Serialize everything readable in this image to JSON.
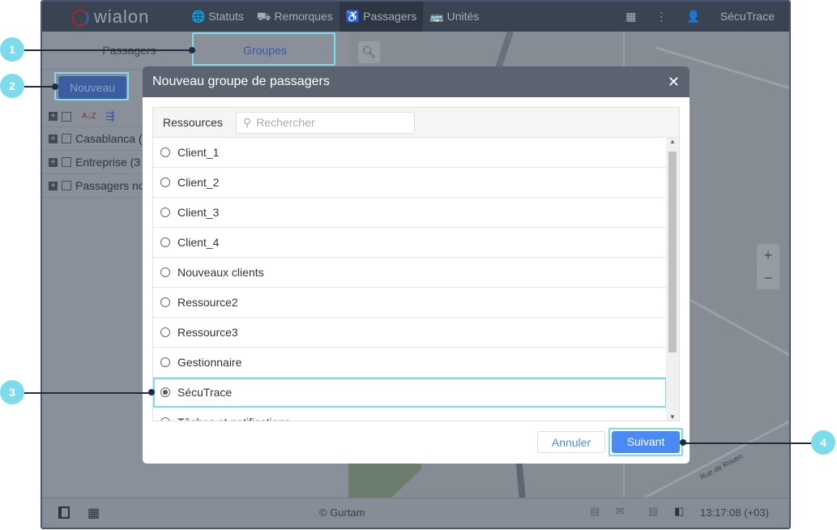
{
  "topbar": {
    "logo": "wialon",
    "nav": [
      "Statuts",
      "Remorques",
      "Passagers",
      "Unités"
    ],
    "user": "SécuTrace"
  },
  "left": {
    "tabs": [
      "Passagers",
      "Groupes"
    ],
    "new_button": "Nouveau",
    "tree": [
      "Casablanca (",
      "Entreprise (3",
      "Passagers no"
    ]
  },
  "dialog": {
    "title": "Nouveau groupe de passagers",
    "resources_label": "Ressources",
    "search_placeholder": "Rechercher",
    "items": [
      "Client_1",
      "Client_2",
      "Client_3",
      "Client_4",
      "Nouveaux clients",
      "Ressource2",
      "Ressource3",
      "Gestionnaire",
      "SécuTrace",
      "Tâches et notifications"
    ],
    "selected": "SécuTrace",
    "cancel": "Annuler",
    "next": "Suivant"
  },
  "bottombar": {
    "copyright": "© Gurtam",
    "time": "13:17:08 (+03)"
  },
  "map": {
    "street": "Rue de Rouen"
  },
  "callouts": [
    "1",
    "2",
    "3",
    "4"
  ]
}
